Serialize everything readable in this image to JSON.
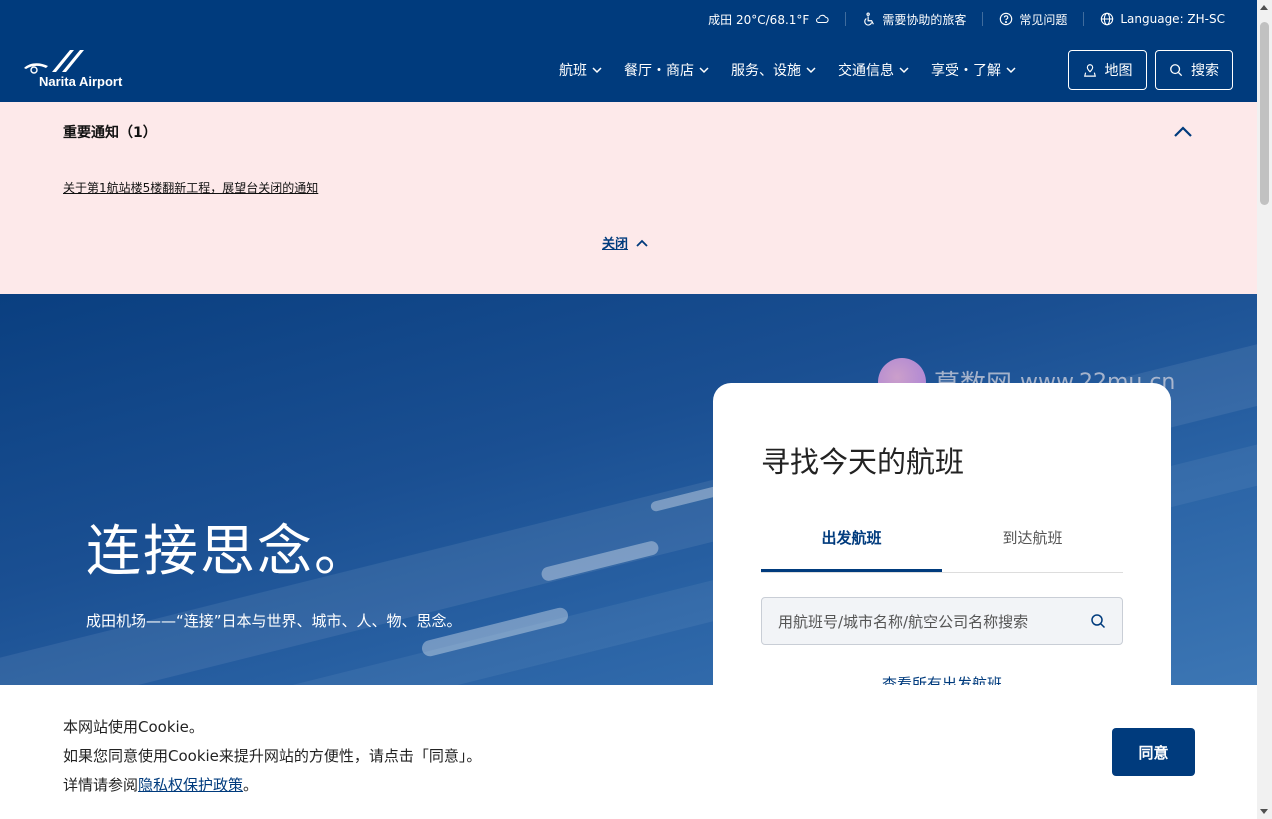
{
  "header": {
    "topbar": {
      "weather": "成田 20°C/68.1°F",
      "assist": "需要协助的旅客",
      "faq": "常见问题",
      "language": "Language: ZH-SC"
    },
    "logo_text": "Narita Airport",
    "nav": [
      "航班",
      "餐厅・商店",
      "服务、设施",
      "交通信息",
      "享受・了解"
    ],
    "map_button": "地图",
    "search_button": "搜索"
  },
  "notice": {
    "title": "重要通知（1）",
    "link": "关于第1航站楼5楼翻新工程，展望台关闭的通知",
    "close": "关闭"
  },
  "hero": {
    "title": "连接思念。",
    "subtitle": "成田机场——“连接”日本与世界、城市、人、物、思念。"
  },
  "flight_card": {
    "title": "寻找今天的航班",
    "tabs": [
      "出发航班",
      "到达航班"
    ],
    "active_tab": "出发航班",
    "search_placeholder": "用航班号/城市名称/航空公司名称搜索",
    "view_all": "查看所有出发航班"
  },
  "watermark": {
    "brand": "慕数网",
    "url": "www.22mu.cn"
  },
  "cookie": {
    "line1": "本网站使用Cookie。",
    "line2": "如果您同意使用Cookie来提升网站的方便性，请点击「同意」。",
    "line3_prefix": "详情请参阅",
    "policy_link": "隐私权保护政策",
    "line3_suffix": "。",
    "agree": "同意"
  },
  "colors": {
    "brand_navy": "#003b7d",
    "notice_bg": "#fde9ea"
  }
}
